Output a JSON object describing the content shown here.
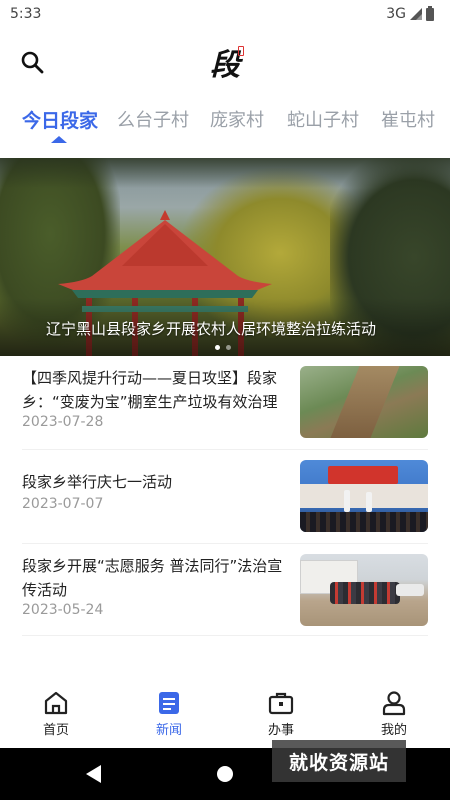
{
  "status_bar": {
    "time": "5:33",
    "network": "3G",
    "icons": [
      "signal-icon",
      "battery-icon"
    ]
  },
  "header": {
    "search_icon": "search-icon",
    "logo_text": "段"
  },
  "tabs": [
    {
      "label": "今日段家",
      "active": true
    },
    {
      "label": "么台子村",
      "active": false
    },
    {
      "label": "庞家村",
      "active": false
    },
    {
      "label": "蛇山子村",
      "active": false
    },
    {
      "label": "崔屯村",
      "active": false
    }
  ],
  "banner": {
    "title": "辽宁黑山县段家乡开展农村人居环境整治拉练活动",
    "dots_total": 2,
    "active_dot": 1
  },
  "news": [
    {
      "title": "【四季风提升行动——夏日攻坚】段家乡：“变废为宝”棚室生产垃圾有效治理",
      "date": "2023-07-28"
    },
    {
      "title": "段家乡举行庆七一活动",
      "date": "2023-07-07"
    },
    {
      "title": "段家乡开展“志愿服务 普法同行”法治宣传活动",
      "date": "2023-05-24"
    }
  ],
  "bottom_nav": [
    {
      "label": "首页",
      "icon": "home-icon",
      "active": false
    },
    {
      "label": "新闻",
      "icon": "news-icon",
      "active": true
    },
    {
      "label": "办事",
      "icon": "briefcase-icon",
      "active": false
    },
    {
      "label": "我的",
      "icon": "profile-icon",
      "active": false
    }
  ],
  "watermark": "就收资源站",
  "colors": {
    "accent": "#3b68e8",
    "tab_inactive": "#9aa0a8",
    "date": "#9a9a9a"
  }
}
